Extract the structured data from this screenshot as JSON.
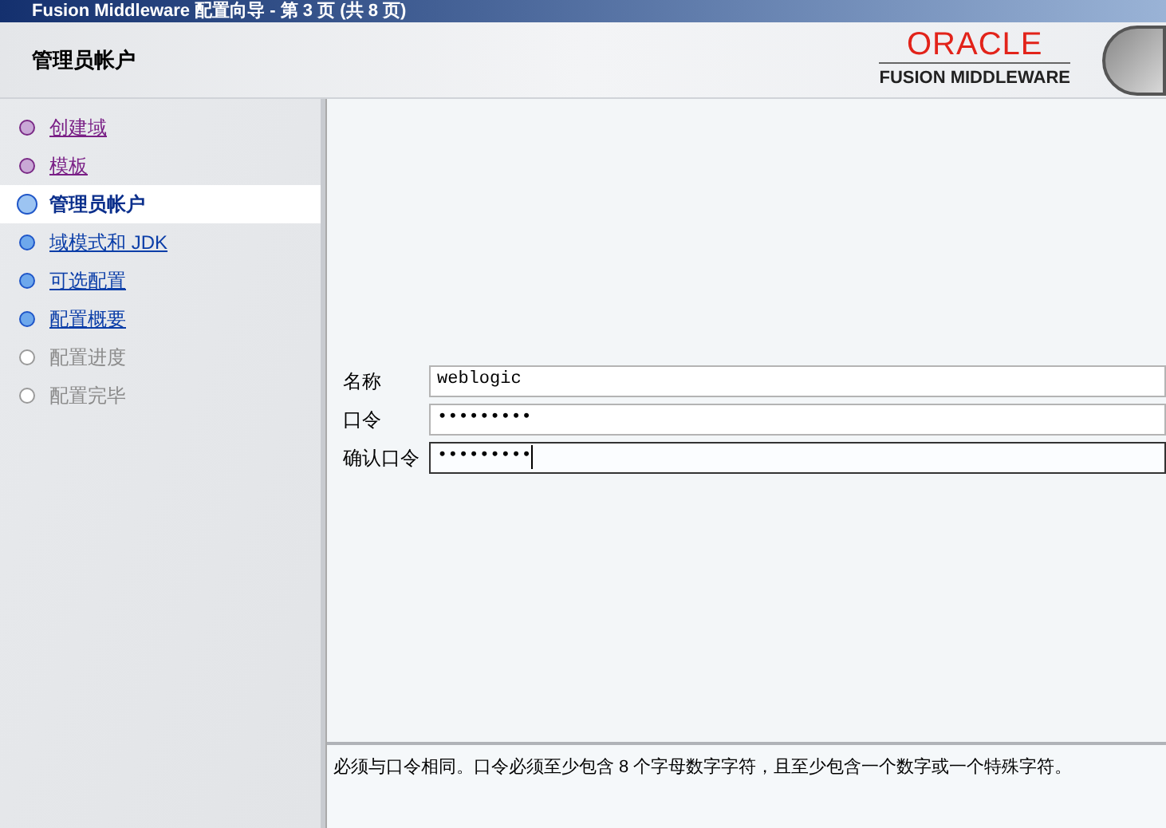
{
  "window": {
    "title": "Fusion Middleware 配置向导 - 第 3 页 (共 8 页)"
  },
  "header": {
    "title": "管理员帐户",
    "brand": "ORACLE",
    "product": "FUSION MIDDLEWARE"
  },
  "steps": [
    {
      "label": "创建域",
      "kind": "visited",
      "selected": false
    },
    {
      "label": "模板",
      "kind": "visited",
      "selected": false
    },
    {
      "label": "管理员帐户",
      "kind": "current",
      "selected": true
    },
    {
      "label": "域模式和 JDK",
      "kind": "available",
      "selected": false
    },
    {
      "label": "可选配置",
      "kind": "available",
      "selected": false
    },
    {
      "label": "配置概要",
      "kind": "available",
      "selected": false
    },
    {
      "label": "配置进度",
      "kind": "disabled",
      "selected": false
    },
    {
      "label": "配置完毕",
      "kind": "disabled",
      "selected": false
    }
  ],
  "form": {
    "fields": [
      {
        "label": "名称",
        "value": "weblogic",
        "focused": false
      },
      {
        "label": "口令",
        "value": "•••••••••",
        "focused": false
      },
      {
        "label": "确认口令",
        "value": "•••••••••",
        "focused": true
      }
    ]
  },
  "help": {
    "text": "必须与口令相同。口令必须至少包含 8 个字母数字字符，且至少包含一个数字或一个特殊字符。"
  }
}
